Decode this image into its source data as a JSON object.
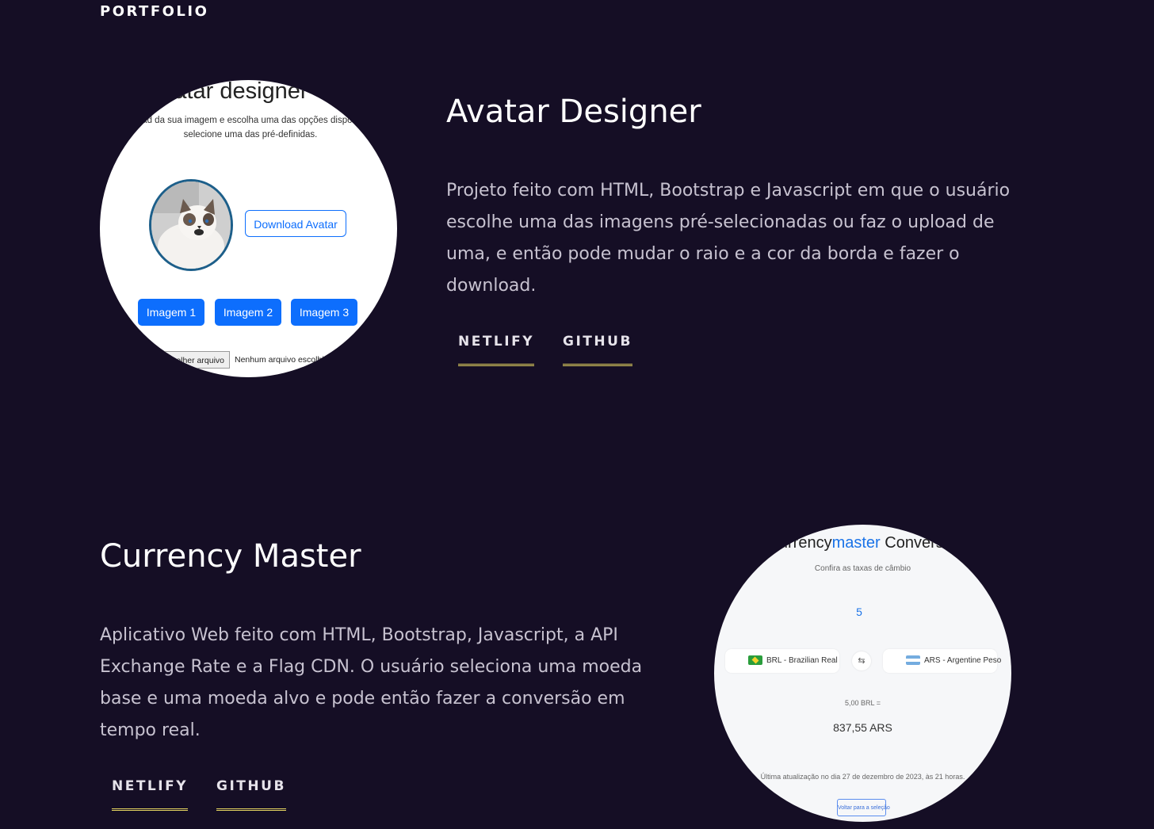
{
  "section": {
    "label": "PORTFOLIO"
  },
  "projects": [
    {
      "title": "Avatar Designer",
      "description": "Projeto feito com HTML, Bootstrap e Javascript em que o usuário escolhe uma das imagens pré-selecionadas ou faz o upload de uma, e então pode mudar o raio e a cor da borda e fazer o download.",
      "links": [
        {
          "label": "NETLIFY"
        },
        {
          "label": "GITHUB"
        }
      ],
      "thumbnail": {
        "heading": "Avatar designer",
        "subtitle_line1": "upload da sua imagem e escolha uma das opções disponíveis",
        "subtitle_line2": "selecione uma das pré-definidas.",
        "download_button": "Download Avatar",
        "image_buttons": [
          "Imagem 1",
          "Imagem 2",
          "Imagem 3"
        ],
        "file_button": "Escolher arquivo",
        "file_status": "Nenhum arquivo escolhido"
      }
    },
    {
      "title": "Currency Master",
      "description": "Aplicativo Web feito com HTML, Bootstrap, Javascript, a API Exchange Rate e a Flag CDN. O usuário seleciona uma moeda base e uma moeda alvo e pode então fazer a conversão em tempo real.",
      "links": [
        {
          "label": "NETLIFY"
        },
        {
          "label": "GITHUB"
        }
      ],
      "thumbnail": {
        "title_part1": "Currency",
        "title_accent": "master",
        "title_part2": " Conversor",
        "subtitle": "Confira as taxas de câmbio",
        "amount": "5",
        "from_currency": "BRL - Brazilian Real",
        "swap_icon": "⇆",
        "to_currency": "ARS - Argentine Peso",
        "from_amount": "5,00 BRL =",
        "result": "837,55 ARS",
        "updated": "Última atualização no dia 27 de dezembro de 2023, às 21 horas.",
        "back_button": "Voltar para a seleção"
      }
    }
  ],
  "colors": {
    "background": "#150e25",
    "underline": "#e5d560",
    "bootstrap_primary": "#0d6efd"
  }
}
